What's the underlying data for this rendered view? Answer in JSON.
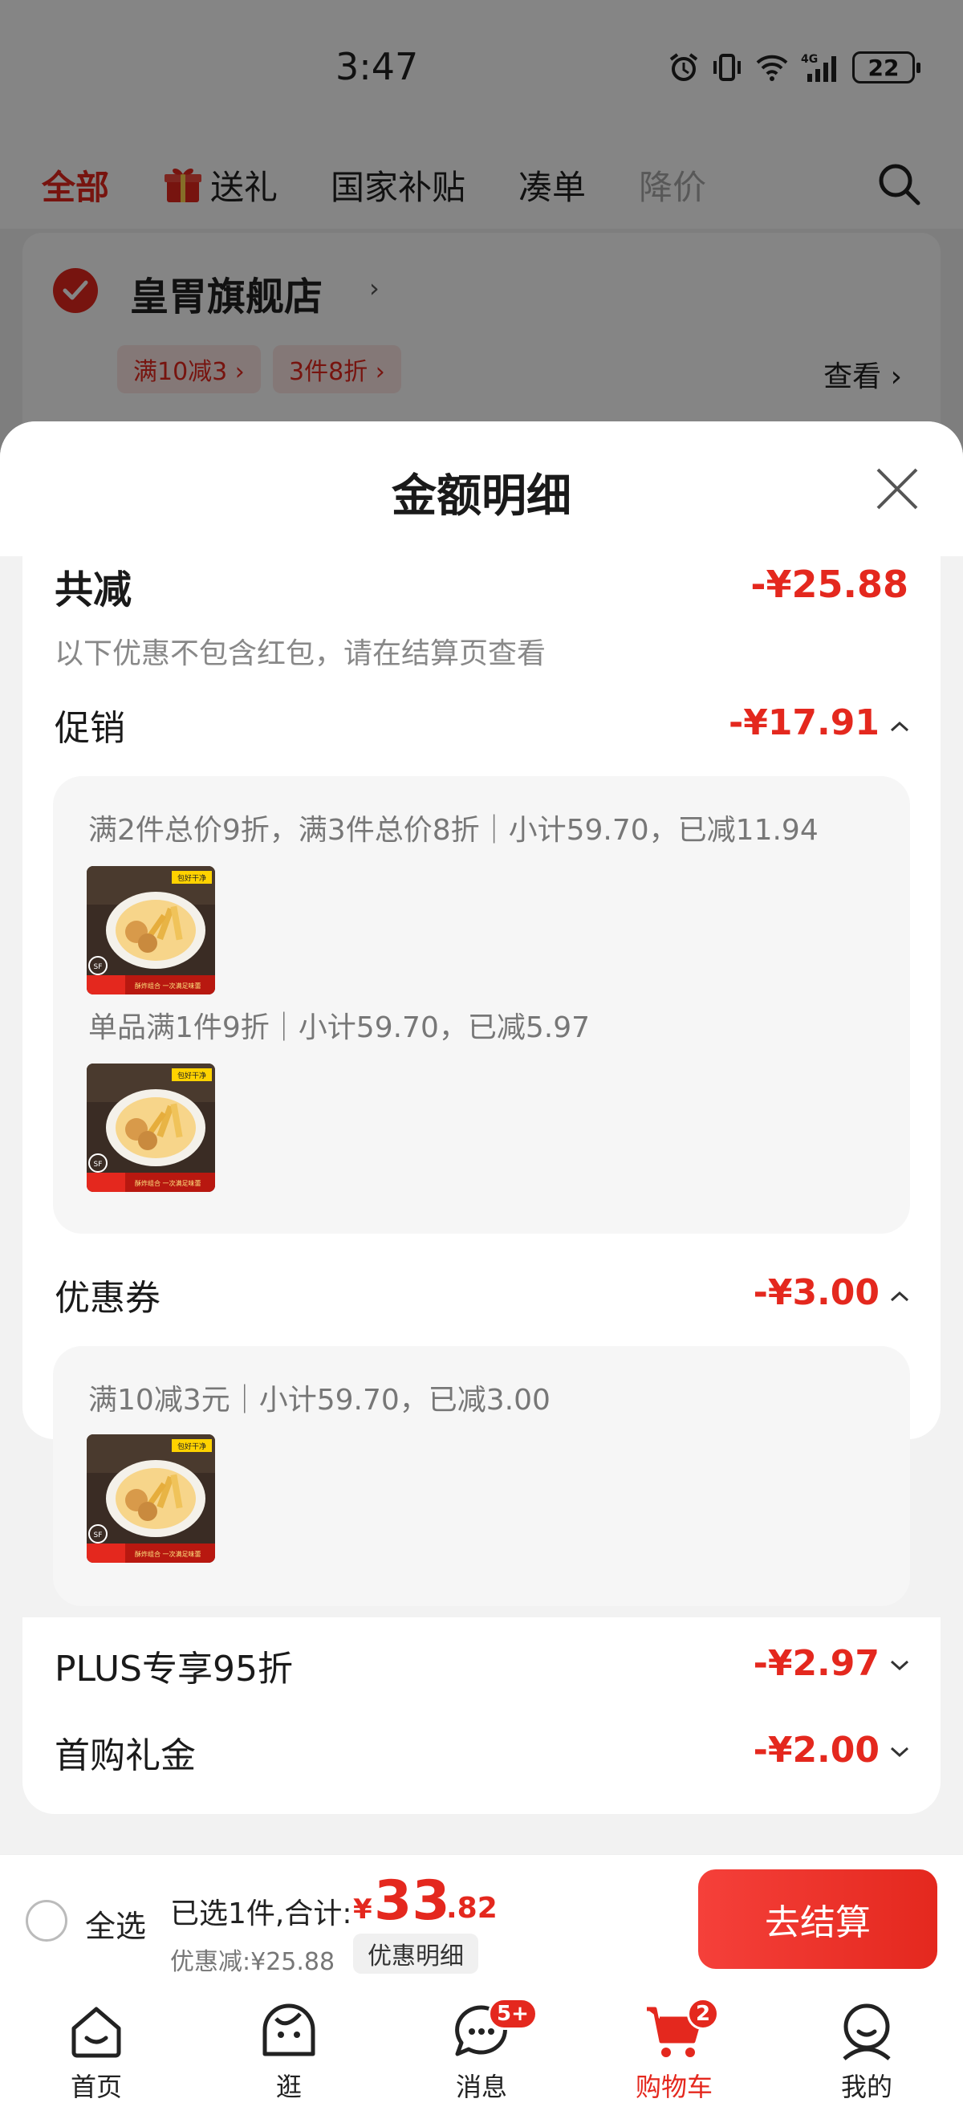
{
  "status_bar": {
    "time": "3:47",
    "network": "4G",
    "battery": "22"
  },
  "tabs": [
    {
      "label": "全部",
      "active": true
    },
    {
      "label": "送礼",
      "icon": "gift-icon"
    },
    {
      "label": "国家补贴"
    },
    {
      "label": "凑单"
    },
    {
      "label": "降价"
    }
  ],
  "store": {
    "name": "皇胃旗舰店",
    "promos": [
      "满10减3 ›",
      "3件8折 ›"
    ],
    "view_label": "查看 ›"
  },
  "sheet": {
    "title": "金额明细",
    "total_label": "共减",
    "total_value": "-¥25.88",
    "total_note": "以下优惠不包含红包，请在结算页查看",
    "promotion": {
      "label": "促销",
      "value": "-¥17.91",
      "items": [
        {
          "text": "满2件总价9折，满3件总价8折｜小计59.70，已减11.94"
        },
        {
          "text": "单品满1件9折｜小计59.70，已减5.97"
        }
      ]
    },
    "coupon": {
      "label": "优惠券",
      "value": "-¥3.00",
      "items": [
        {
          "text": "满10减3元｜小计59.70，已减3.00"
        }
      ]
    },
    "plus": {
      "label": "PLUS专享95折",
      "value": "-¥2.97"
    },
    "first_gift": {
      "label": "首购礼金",
      "value": "-¥2.00"
    }
  },
  "product_thumb": {
    "tag_top": "包好干净",
    "badge": "SF",
    "tag_left": "出口\n香港品质",
    "tag_right": "酥炸组合 一次满足味蕾"
  },
  "checkout": {
    "select_all": "全选",
    "selected_text": "已选1件,合计:",
    "currency": "¥",
    "amount_int": "33",
    "amount_dec": ".82",
    "discount_text": "优惠减:¥25.88",
    "detail_button": "优惠明细",
    "submit": "去结算"
  },
  "nav": [
    {
      "label": "首页",
      "icon": "home-icon"
    },
    {
      "label": "逛",
      "icon": "browse-face-icon"
    },
    {
      "label": "消息",
      "icon": "message-icon",
      "badge": "5+"
    },
    {
      "label": "购物车",
      "icon": "cart-icon",
      "badge": "2",
      "active": true
    },
    {
      "label": "我的",
      "icon": "profile-icon"
    }
  ],
  "colors": {
    "accent": "#e4281e",
    "text": "#1a1a1a",
    "muted": "#777777"
  }
}
